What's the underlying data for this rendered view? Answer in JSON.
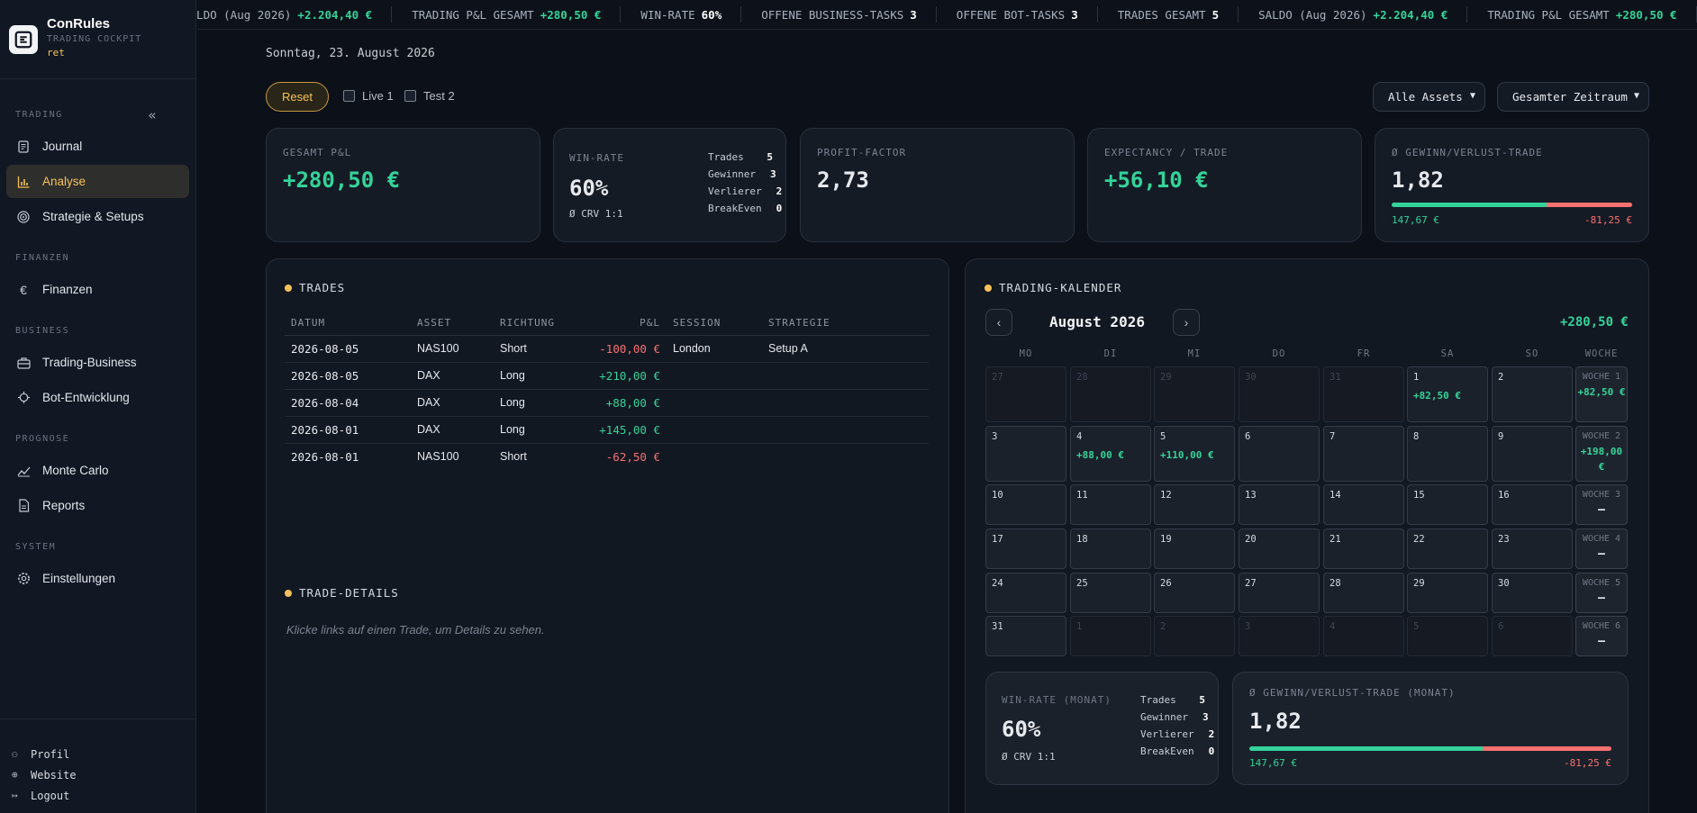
{
  "brand": {
    "name": "ConRules",
    "subtitle": "TRADING COCKPIT",
    "user": "ret"
  },
  "sidebar": {
    "sections": [
      {
        "title": "TRADING"
      },
      {
        "title": "FINANZEN"
      },
      {
        "title": "BUSINESS"
      },
      {
        "title": "PROGNOSE"
      },
      {
        "title": "SYSTEM"
      }
    ],
    "collapse": "«",
    "items": [
      {
        "label": "Journal",
        "icon": "journal-icon"
      },
      {
        "label": "Analyse",
        "icon": "bar-chart-icon"
      },
      {
        "label": "Strategie & Setups",
        "icon": "target-icon"
      },
      {
        "label": "Finanzen",
        "icon": "euro-icon"
      },
      {
        "label": "Trading-Business",
        "icon": "briefcase-icon"
      },
      {
        "label": "Bot-Entwicklung",
        "icon": "bot-icon"
      },
      {
        "label": "Monte Carlo",
        "icon": "trend-icon"
      },
      {
        "label": "Reports",
        "icon": "document-icon"
      },
      {
        "label": "Einstellungen",
        "icon": "gear-icon"
      }
    ],
    "footer": [
      {
        "label": "Profil"
      },
      {
        "label": "Website"
      },
      {
        "label": "Logout"
      }
    ]
  },
  "ticker": [
    {
      "label": "SALDO (Aug 2026)",
      "value": "+2.204,40 €"
    },
    {
      "label": "TRADING P&L GESAMT",
      "value": "+280,50 €"
    },
    {
      "label": "WIN-RATE",
      "value": "60%"
    },
    {
      "label": "OFFENE BUSINESS-TASKS",
      "value": "3"
    },
    {
      "label": "OFFENE BOT-TASKS",
      "value": "3"
    },
    {
      "label": "TRADES GESAMT",
      "value": "5"
    }
  ],
  "header": {
    "date": "Sonntag, 23. August 2026"
  },
  "filters": {
    "reset": "Reset",
    "accounts": [
      "Live 1",
      "Test 2"
    ],
    "asset_select": "Alle Assets",
    "period_select": "Gesamter Zeitraum"
  },
  "kpis": {
    "pnl": {
      "label": "GESAMT P&L",
      "value": "+280,50 €"
    },
    "winrate": {
      "label": "WIN-RATE",
      "value": "60%",
      "crv": "Ø CRV 1:1",
      "trades_label": "Trades",
      "trades": "5",
      "winners_label": "Gewinner",
      "winners": "3",
      "losers_label": "Verlierer",
      "losers": "2",
      "be_label": "BreakEven",
      "be": "0"
    },
    "pf": {
      "label": "PROFIT-FACTOR",
      "value": "2,73"
    },
    "expectancy": {
      "label": "EXPECTANCY / TRADE",
      "value": "+56,10 €"
    },
    "avgwl": {
      "label": "Ø GEWINN/VERLUST-TRADE",
      "value": "1,82",
      "win": "147,67 €",
      "loss": "-81,25 €",
      "win_share": 0.645
    }
  },
  "trades": {
    "title": "TRADES",
    "columns": [
      "DATUM",
      "ASSET",
      "RICHTUNG",
      "P&L",
      "SESSION",
      "STRATEGIE"
    ],
    "rows": [
      [
        "2026-08-05",
        "NAS100",
        "Short",
        "-100,00 €",
        "London",
        "Setup A"
      ],
      [
        "2026-08-05",
        "DAX",
        "Long",
        "+210,00 €",
        "",
        ""
      ],
      [
        "2026-08-04",
        "DAX",
        "Long",
        "+88,00 €",
        "",
        ""
      ],
      [
        "2026-08-01",
        "DAX",
        "Long",
        "+145,00 €",
        "",
        ""
      ],
      [
        "2026-08-01",
        "NAS100",
        "Short",
        "-62,50 €",
        "",
        ""
      ]
    ]
  },
  "details": {
    "title": "TRADE-DETAILS",
    "hint": "Klicke links auf einen Trade, um Details zu sehen."
  },
  "calendar": {
    "title": "TRADING-KALENDER",
    "month": "August 2026",
    "total": "+280,50 €",
    "prev": "‹",
    "next": "›",
    "weekdays": [
      "MO",
      "DI",
      "MI",
      "DO",
      "FR",
      "SA",
      "SO",
      "WOCHE"
    ],
    "weeks": [
      {
        "days": [
          [
            "27",
            ""
          ],
          [
            "28",
            ""
          ],
          [
            "29",
            ""
          ],
          [
            "30",
            ""
          ],
          [
            "31",
            ""
          ],
          [
            "1",
            "+82,50 €"
          ],
          [
            "2",
            ""
          ]
        ],
        "label": "WOCHE 1",
        "value": "+82,50 €"
      },
      {
        "days": [
          [
            "3",
            ""
          ],
          [
            "4",
            "+88,00 €"
          ],
          [
            "5",
            "+110,00 €"
          ],
          [
            "6",
            ""
          ],
          [
            "7",
            ""
          ],
          [
            "8",
            ""
          ],
          [
            "9",
            ""
          ]
        ],
        "label": "WOCHE 2",
        "value": "+198,00 €"
      },
      {
        "days": [
          [
            "10",
            ""
          ],
          [
            "11",
            ""
          ],
          [
            "12",
            ""
          ],
          [
            "13",
            ""
          ],
          [
            "14",
            ""
          ],
          [
            "15",
            ""
          ],
          [
            "16",
            ""
          ]
        ],
        "label": "WOCHE 3",
        "value": "—"
      },
      {
        "days": [
          [
            "17",
            ""
          ],
          [
            "18",
            ""
          ],
          [
            "19",
            ""
          ],
          [
            "20",
            ""
          ],
          [
            "21",
            ""
          ],
          [
            "22",
            ""
          ],
          [
            "23",
            ""
          ]
        ],
        "label": "WOCHE 4",
        "value": "—"
      },
      {
        "days": [
          [
            "24",
            ""
          ],
          [
            "25",
            ""
          ],
          [
            "26",
            ""
          ],
          [
            "27",
            ""
          ],
          [
            "28",
            ""
          ],
          [
            "29",
            ""
          ],
          [
            "30",
            ""
          ]
        ],
        "label": "WOCHE 5",
        "value": "—"
      },
      {
        "days": [
          [
            "31",
            ""
          ],
          [
            "1",
            ""
          ],
          [
            "2",
            ""
          ],
          [
            "3",
            ""
          ],
          [
            "4",
            ""
          ],
          [
            "5",
            ""
          ],
          [
            "6",
            ""
          ]
        ],
        "label": "WOCHE 6",
        "value": "—"
      }
    ],
    "month_winrate": {
      "label": "WIN-RATE (MONAT)",
      "value": "60%",
      "crv": "Ø CRV 1:1",
      "trades_label": "Trades",
      "trades": "5",
      "winners_label": "Gewinner",
      "winners": "3",
      "losers_label": "Verlierer",
      "losers": "2",
      "be_label": "BreakEven",
      "be": "0"
    },
    "month_avgwl": {
      "label": "Ø GEWINN/VERLUST-TRADE (MONAT)",
      "value": "1,82",
      "win": "147,67 €",
      "loss": "-81,25 €",
      "win_share": 0.645
    }
  }
}
